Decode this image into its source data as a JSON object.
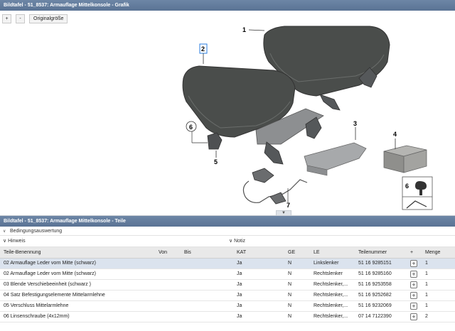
{
  "graphic_panel": {
    "title": "Bildtafel - 51_8537: Armauflage Mittelkonsole - Grafik",
    "zoom_in_label": "+",
    "zoom_out_label": "-",
    "original_size_label": "Originalgröße",
    "callouts": [
      "1",
      "2",
      "3",
      "4",
      "5",
      "6",
      "7"
    ],
    "legend_number": "6",
    "collapse_arrow": "▼"
  },
  "parts_panel": {
    "title": "Bildtafel - 51_8537: Armauflage Mittelkonsole - Teile",
    "sections": {
      "conditions": "Bedingungsauswertung",
      "hint": "Hinweis",
      "note": "Notiz"
    },
    "columns": [
      "Teile-Benennung",
      "Von",
      "Bis",
      "KAT",
      "GE",
      "LE",
      "Teilenummer",
      "+",
      "Menge"
    ],
    "rows": [
      {
        "name": "02 Armauflage Leder vorn Mitte (schwarz)",
        "von": "",
        "bis": "",
        "kat": "Ja",
        "ge": "N",
        "le": "Linkslenker",
        "part_no": "51 16 9285151",
        "qty": "1"
      },
      {
        "name": "02 Armauflage Leder vorn Mitte (schwarz)",
        "von": "",
        "bis": "",
        "kat": "Ja",
        "ge": "N",
        "le": "Rechtslenker",
        "part_no": "51 16 9285160",
        "qty": "1"
      },
      {
        "name": "03 Blende Verschiebeeinheit (schwarz )",
        "von": "",
        "bis": "",
        "kat": "Ja",
        "ge": "N",
        "le": "Rechtslenker,...",
        "part_no": "51 16 9253558",
        "qty": "1"
      },
      {
        "name": "04 Satz Befestigungselemente Mittelarmlehne",
        "von": "",
        "bis": "",
        "kat": "Ja",
        "ge": "N",
        "le": "Rechtslenker,...",
        "part_no": "51 16 9252682",
        "qty": "1"
      },
      {
        "name": "05 Verschluss Mittelarmlehne",
        "von": "",
        "bis": "",
        "kat": "Ja",
        "ge": "N",
        "le": "Rechtslenker,...",
        "part_no": "51 16 9232069",
        "qty": "1"
      },
      {
        "name": "06 Linsenschraube (4x12mm)",
        "von": "",
        "bis": "",
        "kat": "Ja",
        "ge": "N",
        "le": "Rechtslenker,...",
        "part_no": "07 14 7122390",
        "qty": "2"
      }
    ],
    "selected_row": 0
  },
  "colors": {
    "titlebar": "#5f7899",
    "selected_row": "#dbe3ee",
    "callout_highlight": "#2a7de1"
  }
}
